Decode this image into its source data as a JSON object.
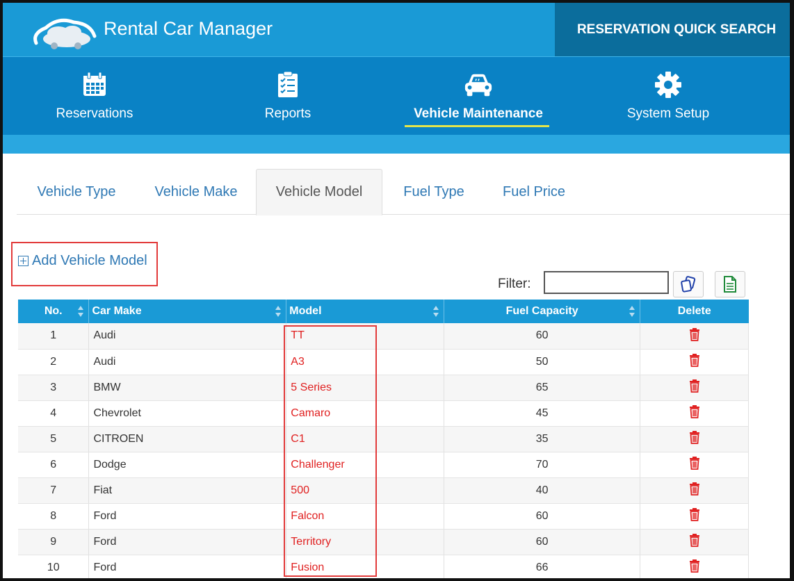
{
  "app": {
    "title": "Rental Car Manager",
    "quick_search_label": "RESERVATION QUICK SEARCH"
  },
  "nav": {
    "items": [
      {
        "label": "Reservations",
        "icon": "calendar-icon"
      },
      {
        "label": "Reports",
        "icon": "checklist-icon"
      },
      {
        "label": "Vehicle Maintenance",
        "icon": "car-icon",
        "active": true
      },
      {
        "label": "System Setup",
        "icon": "gear-icon"
      }
    ]
  },
  "tabs": {
    "items": [
      {
        "label": "Vehicle Type"
      },
      {
        "label": "Vehicle Make"
      },
      {
        "label": "Vehicle Model",
        "active": true
      },
      {
        "label": "Fuel Type"
      },
      {
        "label": "Fuel Price"
      }
    ]
  },
  "actions": {
    "add_label": "Add Vehicle Model"
  },
  "filter": {
    "label": "Filter:",
    "value": ""
  },
  "table": {
    "headers": {
      "no": "No.",
      "car_make": "Car Make",
      "model": "Model",
      "fuel_capacity": "Fuel Capacity",
      "delete": "Delete"
    },
    "rows": [
      {
        "no": "1",
        "make": "Audi",
        "model": "TT",
        "capacity": "60"
      },
      {
        "no": "2",
        "make": "Audi",
        "model": "A3",
        "capacity": "50"
      },
      {
        "no": "3",
        "make": "BMW",
        "model": "5 Series",
        "capacity": "65"
      },
      {
        "no": "4",
        "make": "Chevrolet",
        "model": "Camaro",
        "capacity": "45"
      },
      {
        "no": "5",
        "make": "CITROEN",
        "model": "C1",
        "capacity": "35"
      },
      {
        "no": "6",
        "make": "Dodge",
        "model": "Challenger",
        "capacity": "70"
      },
      {
        "no": "7",
        "make": "Fiat",
        "model": "500",
        "capacity": "40"
      },
      {
        "no": "8",
        "make": "Ford",
        "model": "Falcon",
        "capacity": "60"
      },
      {
        "no": "9",
        "make": "Ford",
        "model": "Territory",
        "capacity": "60"
      },
      {
        "no": "10",
        "make": "Ford",
        "model": "Fusion",
        "capacity": "66"
      }
    ]
  },
  "colors": {
    "topbar": "#1a9ad6",
    "quick_search_bg": "#0b6d9c",
    "navbar": "#0a82c5",
    "nav_active_underline": "#e4e44a",
    "link": "#2e78b4",
    "model_text": "#e02020",
    "highlight_box": "#e23a3a"
  }
}
